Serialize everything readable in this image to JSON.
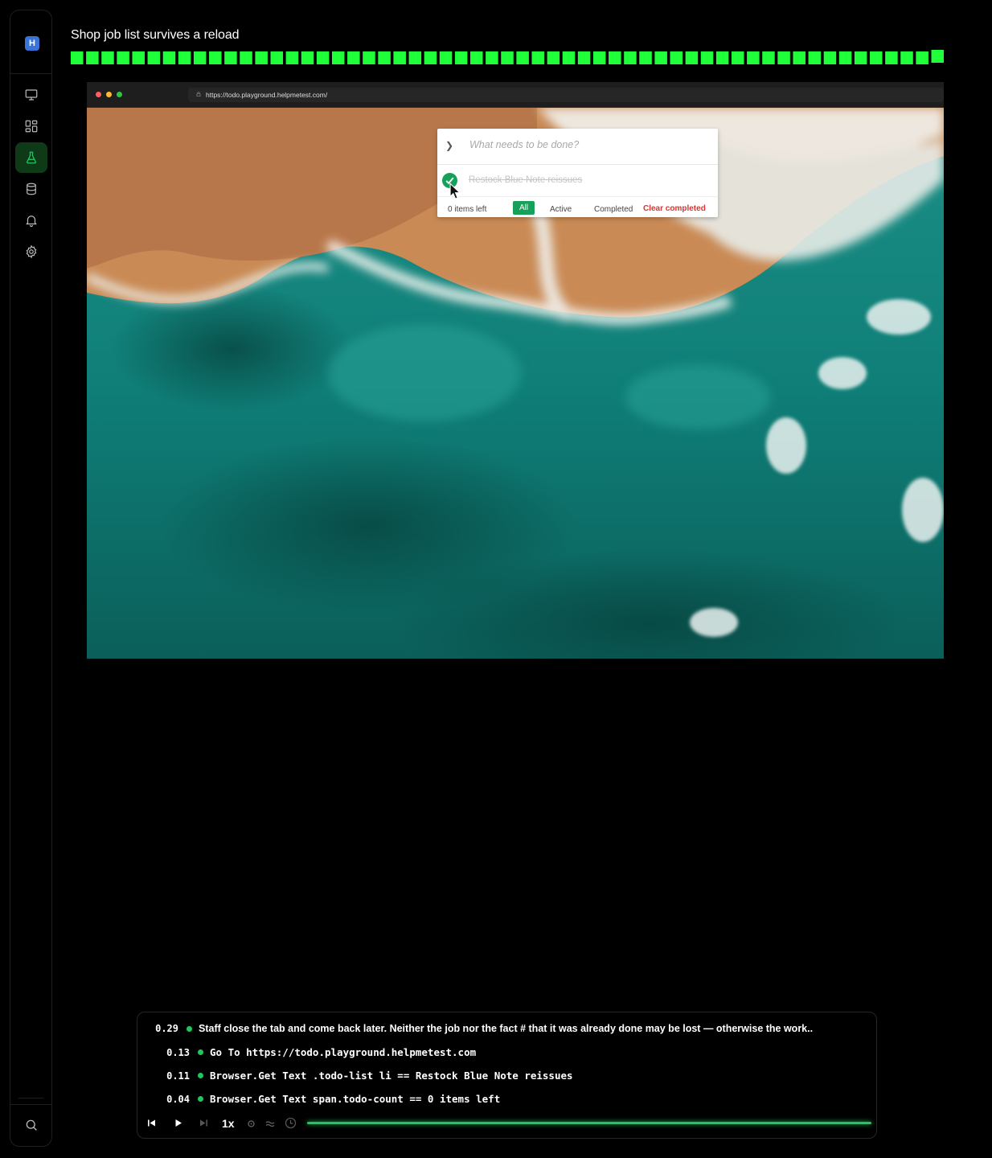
{
  "app": {
    "logo_letter": "H",
    "accent": "#22c55e",
    "brand": "#3b74d8"
  },
  "sidebar": {
    "items": [
      {
        "name": "monitor-icon",
        "active": false
      },
      {
        "name": "dashboard-icon",
        "active": false
      },
      {
        "name": "flask-icon",
        "active": true
      },
      {
        "name": "database-icon",
        "active": false
      },
      {
        "name": "bell-icon",
        "active": false
      },
      {
        "name": "gear-icon",
        "active": false
      }
    ],
    "footer_icon": "search-icon"
  },
  "test": {
    "title": "Shop job list survives a reload",
    "step_segments": 57,
    "progress": 1.0
  },
  "browser": {
    "url": "https://todo.playground.helpmetest.com/"
  },
  "todo": {
    "placeholder": "What needs to be done?",
    "items": [
      {
        "label": "Restock Blue Note reissues",
        "completed": true
      }
    ],
    "count_number": "0",
    "count_label": " items left",
    "filters": {
      "all": "All",
      "active": "Active",
      "completed": "Completed"
    },
    "clear_completed": "Clear completed"
  },
  "log": {
    "rows": [
      {
        "time": "0.29",
        "text": "Staff close the tab and come back later. Neither the job nor the fact # that it was already done may be lost — otherwise the work.."
      },
      {
        "time": "0.13",
        "text": "Go To https://todo.playground.helpmetest.com"
      },
      {
        "time": "0.11",
        "text": "Browser.Get Text .todo-list li == Restock Blue Note reissues"
      },
      {
        "time": "0.04",
        "text": "Browser.Get Text span.todo-count == 0 items left"
      }
    ],
    "speed": "1x",
    "playback_progress": 1.0
  }
}
